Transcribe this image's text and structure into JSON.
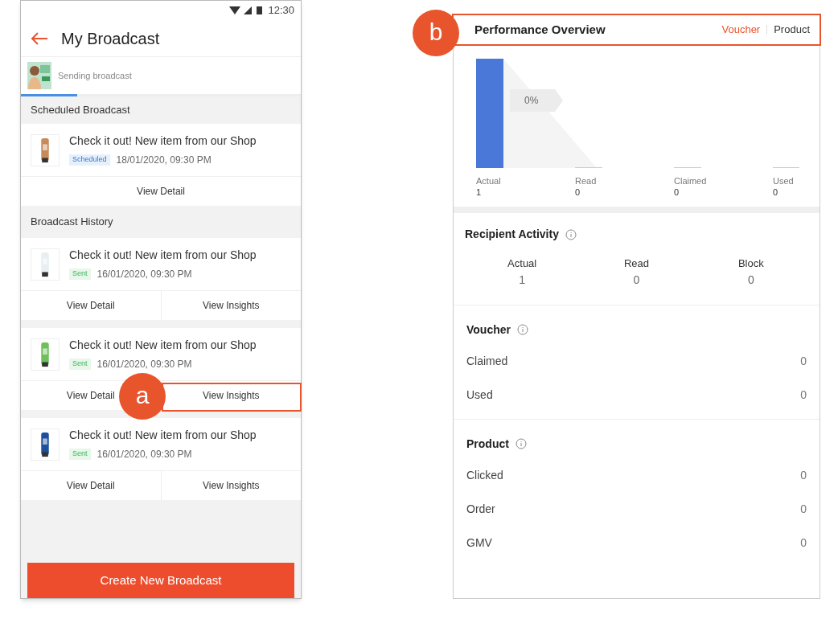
{
  "phone": {
    "status_time": "12:30",
    "title": "My Broadcast",
    "sending": {
      "label": "Sending broadcast",
      "level": 0.2
    },
    "scheduled_header": "Scheduled Broadcast",
    "scheduled": [
      {
        "title": "Check it out! New item from our Shop",
        "status": "Scheduled",
        "kind": "scheduled",
        "date": "18/01/2020, 09:30 PM",
        "actions": [
          "View Detail"
        ]
      }
    ],
    "history_header": "Broadcast History",
    "history": [
      {
        "title": "Check it out! New item from our Shop",
        "status": "Sent",
        "kind": "sent",
        "date": "16/01/2020, 09:30 PM",
        "actions": [
          "View Detail",
          "View Insights"
        ]
      },
      {
        "title": "Check it out! New item from our Shop",
        "status": "Sent",
        "kind": "sent",
        "date": "16/01/2020, 09:30 PM",
        "actions": [
          "View Detail",
          "View Insights"
        ]
      },
      {
        "title": "Check it out! New item from our Shop",
        "status": "Sent",
        "kind": "sent",
        "date": "16/01/2020, 09:30 PM",
        "actions": [
          "View Detail",
          "View Insights"
        ]
      }
    ],
    "create_button": "Create New Broadcast"
  },
  "callouts": [
    {
      "label": "a"
    },
    {
      "label": "b"
    }
  ],
  "insights": {
    "title": "Performance Overview",
    "tabs": [
      {
        "label": "Voucher",
        "selected": true
      },
      {
        "label": "Product",
        "selected": false
      }
    ],
    "funnel": {
      "conversion": "0%",
      "chart_data": {
        "type": "bar",
        "categories": [
          "Actual",
          "Read",
          "Claimed",
          "Used"
        ],
        "values": [
          1,
          0,
          0,
          0
        ],
        "data_labels": true
      },
      "value_labels": [
        "1",
        "0",
        "0",
        "0"
      ]
    },
    "recipient_activity": {
      "title": "Recipient Activity",
      "stats": [
        {
          "label": "Actual",
          "value": "1"
        },
        {
          "label": "Read",
          "value": "0"
        },
        {
          "label": "Block",
          "value": "0"
        }
      ]
    },
    "sections": [
      {
        "title": "Voucher",
        "rows": [
          {
            "label": "Claimed",
            "value": "0"
          },
          {
            "label": "Used",
            "value": "0"
          }
        ]
      },
      {
        "title": "Product",
        "rows": [
          {
            "label": "Clicked",
            "value": "0"
          },
          {
            "label": "Order",
            "value": "0"
          },
          {
            "label": "GMV",
            "value": "0"
          }
        ]
      }
    ]
  }
}
